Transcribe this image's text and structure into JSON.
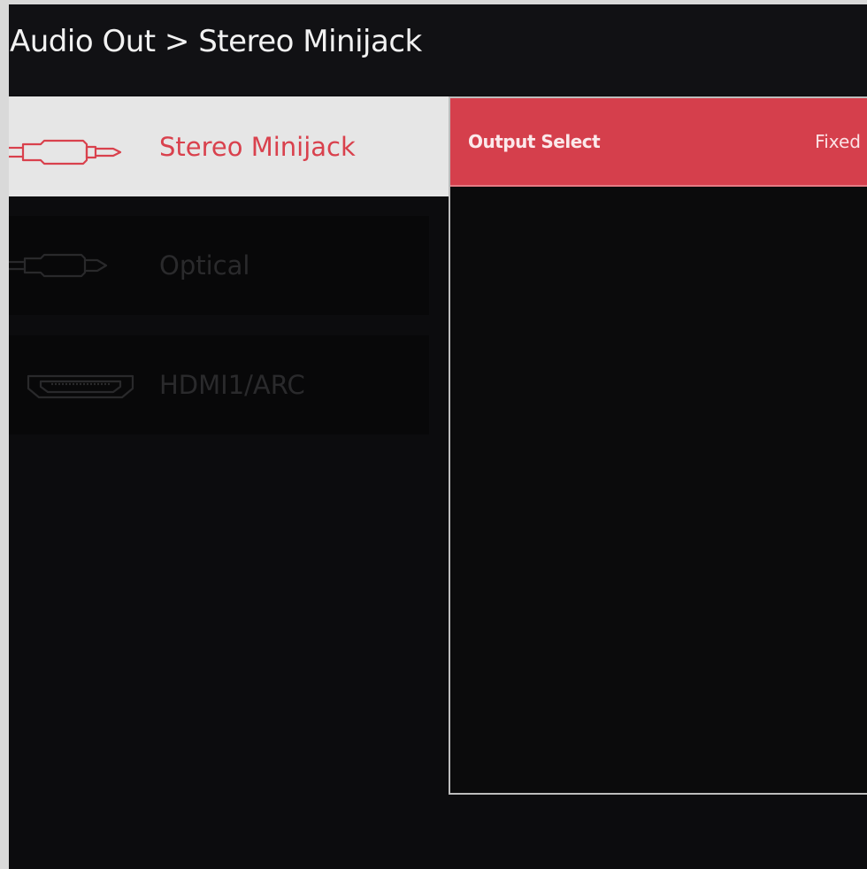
{
  "header": {
    "breadcrumb": "Audio Out > Stereo Minijack"
  },
  "menu": {
    "items": [
      {
        "label": "Stereo Minijack",
        "icon": "minijack-icon",
        "selected": true
      },
      {
        "label": "Optical",
        "icon": "optical-icon",
        "selected": false
      },
      {
        "label": "HDMI1/ARC",
        "icon": "hdmi-icon",
        "selected": false
      }
    ]
  },
  "panel": {
    "rows": [
      {
        "label": "Output Select",
        "value": "Fixed"
      }
    ]
  },
  "colors": {
    "accent": "#d53f4c",
    "background": "#0c0c0e",
    "selected_item_bg": "#e6e6e6"
  }
}
